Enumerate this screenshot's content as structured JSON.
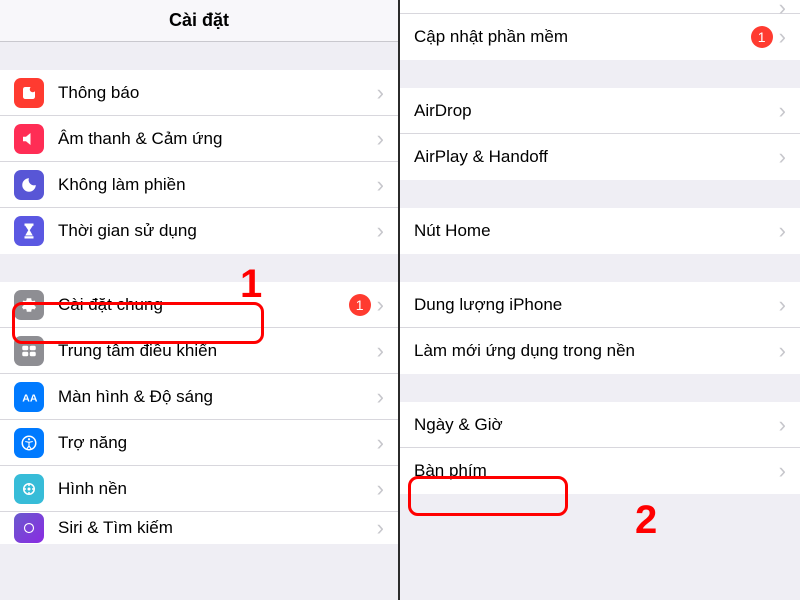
{
  "left": {
    "title": "Cài đặt",
    "group1": [
      {
        "label": "Thông báo",
        "icon": "notif"
      },
      {
        "label": "Âm thanh & Cảm ứng",
        "icon": "sound"
      },
      {
        "label": "Không làm phiền",
        "icon": "dnd"
      },
      {
        "label": "Thời gian sử dụng",
        "icon": "screentime"
      }
    ],
    "group2": [
      {
        "label": "Cài đặt chung",
        "icon": "general",
        "badge": "1"
      },
      {
        "label": "Trung tâm điều khiển",
        "icon": "control"
      },
      {
        "label": "Màn hình & Độ sáng",
        "icon": "display"
      },
      {
        "label": "Trợ năng",
        "icon": "access"
      },
      {
        "label": "Hình nền",
        "icon": "wall"
      },
      {
        "label": "Siri & Tìm kiếm",
        "icon": "siri"
      }
    ]
  },
  "right": {
    "partial_top": "",
    "group0": [
      {
        "label": "Cập nhật phần mềm",
        "badge": "1"
      }
    ],
    "group1": [
      {
        "label": "AirDrop"
      },
      {
        "label": "AirPlay & Handoff"
      }
    ],
    "group2": [
      {
        "label": "Nút Home"
      }
    ],
    "group3": [
      {
        "label": "Dung lượng iPhone"
      },
      {
        "label": "Làm mới ứng dụng trong nền"
      }
    ],
    "group4": [
      {
        "label": "Ngày & Giờ"
      },
      {
        "label": "Bàn phím"
      }
    ]
  },
  "annotations": {
    "num1": "1",
    "num2": "2"
  }
}
